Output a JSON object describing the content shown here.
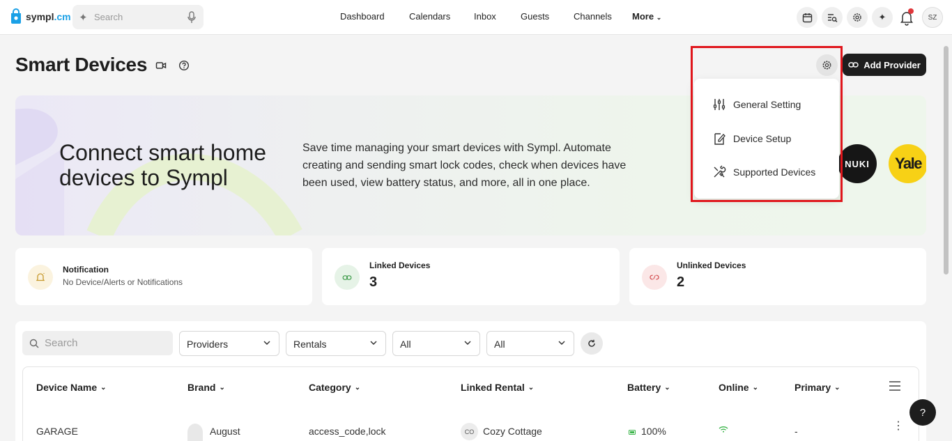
{
  "app": {
    "logo_text": "sympl",
    "logo_suffix": ".cm"
  },
  "header": {
    "search_placeholder": "Search",
    "nav": [
      "Dashboard",
      "Calendars",
      "Inbox",
      "Guests",
      "Channels"
    ],
    "more_label": "More",
    "avatar_initials": "SZ"
  },
  "page": {
    "title": "Smart Devices",
    "add_provider_label": "Add Provider"
  },
  "banner": {
    "heading": "Connect smart home devices to Sympl",
    "description": "Save time managing your smart devices with Sympl. Automate creating and sending smart lock codes, check when devices have been used, view battery status, and more, all in one place.",
    "brand_logos": [
      "NUKI",
      "Yale"
    ]
  },
  "settings_menu": {
    "items": [
      "General Setting",
      "Device Setup",
      "Supported Devices"
    ]
  },
  "stats": {
    "notification": {
      "label": "Notification",
      "text": "No Device/Alerts or Notifications"
    },
    "linked": {
      "label": "Linked Devices",
      "value": "3"
    },
    "unlinked": {
      "label": "Unlinked Devices",
      "value": "2"
    }
  },
  "filters": {
    "search_placeholder": "Search",
    "providers": "Providers",
    "rentals": "Rentals",
    "filter3": "All",
    "filter4": "All"
  },
  "table": {
    "columns": [
      "Device Name",
      "Brand",
      "Category",
      "Linked Rental",
      "Battery",
      "Online",
      "Primary"
    ],
    "rows": [
      {
        "device_name": "GARAGE",
        "brand": "August",
        "category": "access_code,lock",
        "rental_initials": "CO",
        "rental": "Cozy Cottage",
        "battery": "100%",
        "primary": "-"
      }
    ]
  },
  "help_label": "?",
  "colors": {
    "accent_red": "#e0151b",
    "dark": "#1e1e1e",
    "brand_blue": "#1aa0e6",
    "battery_green": "#3bb54a"
  }
}
